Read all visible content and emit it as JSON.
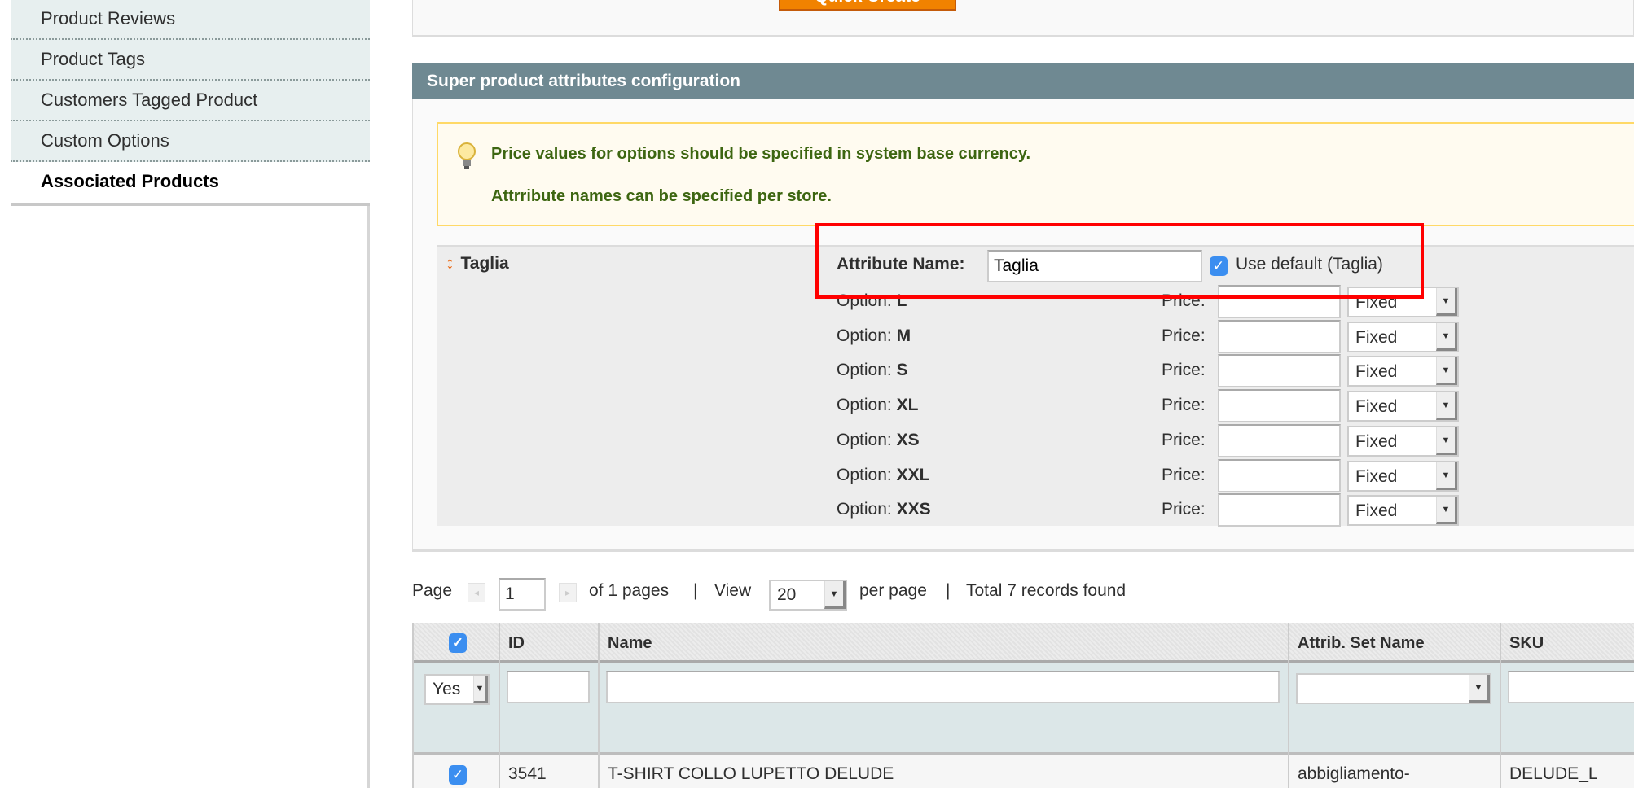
{
  "sidebar": {
    "items": [
      {
        "label": "Product Reviews"
      },
      {
        "label": "Product Tags"
      },
      {
        "label": "Customers Tagged Product"
      },
      {
        "label": "Custom Options"
      },
      {
        "label": "Associated Products",
        "active": true
      }
    ]
  },
  "top": {
    "quick_create_label": "Quick Create"
  },
  "section": {
    "title": "Super product attributes configuration"
  },
  "notice": {
    "icon": "lightbulb-icon",
    "line1": "Price values for options should be specified in system base currency.",
    "line2": "Attrribute names can be specified per store."
  },
  "attribute": {
    "title": "Taglia",
    "name_label": "Attribute Name:",
    "name_value": "Taglia",
    "use_default_label": "Use default (Taglia)",
    "use_default_checked": true,
    "option_prefix": "Option:",
    "price_label": "Price:",
    "options": [
      {
        "code": "L",
        "price": "",
        "type": "Fixed"
      },
      {
        "code": "M",
        "price": "",
        "type": "Fixed"
      },
      {
        "code": "S",
        "price": "",
        "type": "Fixed"
      },
      {
        "code": "XL",
        "price": "",
        "type": "Fixed"
      },
      {
        "code": "XS",
        "price": "",
        "type": "Fixed"
      },
      {
        "code": "XXL",
        "price": "",
        "type": "Fixed"
      },
      {
        "code": "XXS",
        "price": "",
        "type": "Fixed"
      }
    ]
  },
  "pager": {
    "page_label": "Page",
    "page_value": "1",
    "of_pages": "of 1 pages",
    "sep": "|",
    "view_label": "View",
    "view_value": "20",
    "per_page": "per page",
    "total": "Total 7 records found"
  },
  "grid": {
    "columns": [
      "",
      "ID",
      "Name",
      "Attrib. Set Name",
      "SKU"
    ],
    "filters": {
      "in_products": "Yes",
      "id": "",
      "name": "",
      "attrib_set": "",
      "sku": ""
    },
    "rows": [
      {
        "checked": true,
        "id": "3541",
        "name": "T-SHIRT COLLO LUPETTO DELUDE",
        "attrib_set": "abbigliamento-",
        "sku": "DELUDE_L"
      }
    ]
  },
  "colors": {
    "header": "#6f8992",
    "notice_text": "#3d6611",
    "highlight": "#ff0000",
    "button": "#f18200"
  }
}
